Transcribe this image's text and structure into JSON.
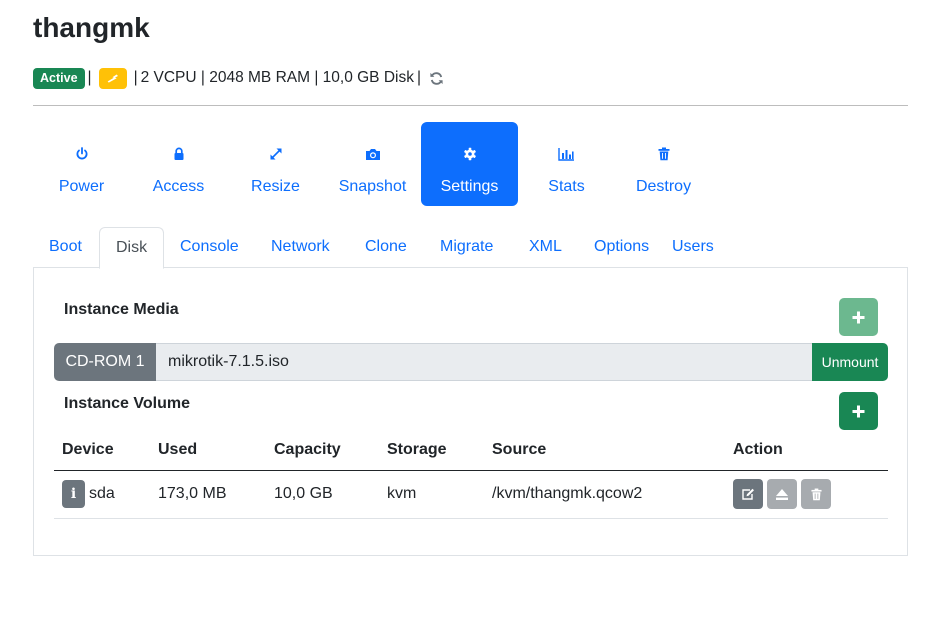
{
  "instance": {
    "name": "thangmk",
    "status": "Active",
    "sep": "|",
    "specs": "2 VCPU | 2048 MB RAM | 10,0 GB Disk",
    "status_color": "#198754",
    "power_badge_color": "#ffc107"
  },
  "nav": {
    "active": "Settings",
    "items": [
      {
        "label": "Power",
        "icon": "power-icon"
      },
      {
        "label": "Access",
        "icon": "lock-icon"
      },
      {
        "label": "Resize",
        "icon": "expand-icon"
      },
      {
        "label": "Snapshot",
        "icon": "camera-icon"
      },
      {
        "label": "Settings",
        "icon": "gear-icon"
      },
      {
        "label": "Stats",
        "icon": "bar-chart-icon"
      },
      {
        "label": "Destroy",
        "icon": "trash-icon"
      }
    ]
  },
  "tabs": {
    "active": "Disk",
    "items": [
      "Boot",
      "Disk",
      "Console",
      "Network",
      "Clone",
      "Migrate",
      "XML",
      "Options",
      "Users"
    ]
  },
  "media": {
    "title": "Instance Media",
    "device_label": "CD-ROM 1",
    "value": "mikrotik-7.1.5.iso",
    "unmount_label": "Unmount"
  },
  "volume": {
    "title": "Instance Volume",
    "columns": [
      "Device",
      "Used",
      "Capacity",
      "Storage",
      "Source",
      "Action"
    ],
    "rows": [
      {
        "device": "sda",
        "used": "173,0 MB",
        "capacity": "10,0 GB",
        "storage": "kvm",
        "source": "/kvm/thangmk.qcow2"
      }
    ]
  },
  "colors": {
    "primary": "#0d6efd",
    "success": "#198754",
    "secondary": "#6c757d"
  }
}
